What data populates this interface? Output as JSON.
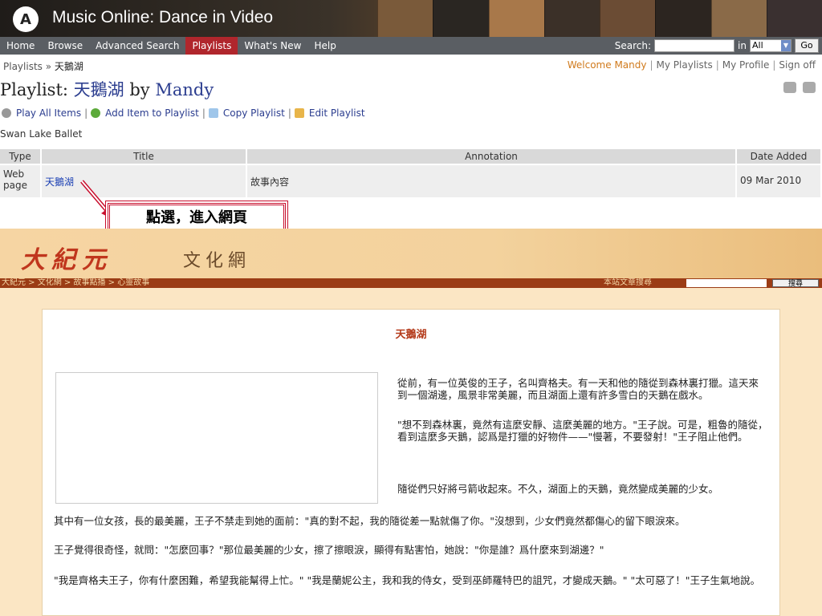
{
  "header": {
    "logo_letter": "A",
    "site_title": "Music Online: Dance in Video"
  },
  "nav": {
    "items": [
      "Home",
      "Browse",
      "Advanced Search",
      "Playlists",
      "What's New",
      "Help"
    ],
    "active": "Playlists",
    "search_label": "Search:",
    "in_label": "in",
    "scope_value": "All",
    "go_label": "Go"
  },
  "breadcrumb": {
    "root": "Playlists",
    "sep": "»",
    "current": "天鵝湖"
  },
  "userbar": {
    "welcome": "Welcome Mandy",
    "my_playlists": "My Playlists",
    "my_profile": "My Profile",
    "sign_off": "Sign off"
  },
  "playlist": {
    "label": "Playlist:",
    "name": "天鵝湖",
    "by": "by",
    "owner": "Mandy",
    "description": "Swan Lake Ballet"
  },
  "actions": {
    "play_all": "Play All Items",
    "add_item": "Add Item to Playlist",
    "copy": "Copy Playlist",
    "edit": "Edit Playlist"
  },
  "table": {
    "headers": [
      "Type",
      "Title",
      "Annotation",
      "Date Added"
    ],
    "rows": [
      {
        "type": "Web page",
        "title": "天鵝湖",
        "annotation": "故事內容",
        "date": "09 Mar 2010"
      }
    ]
  },
  "callout": {
    "text": "點選，進入網頁"
  },
  "web": {
    "brand": "大紀元",
    "brand2": "文化網",
    "breadcrumb": "大紀元 > 文化網 > 故事點播 > 心靈故事",
    "search_label": "本站文章搜尋",
    "search_button": "搜尋",
    "article_title": "天鵝湖",
    "paragraphs": [
      "從前，有一位英俊的王子，名叫齊格夫。有一天和他的隨從到森林裏打獵。這天來到一個湖邊，風景非常美麗，而且湖面上還有許多雪白的天鵝在戲水。",
      "\"想不到森林裏，竟然有這麼安靜、這麼美麗的地方。\"王子說。可是，粗魯的隨從，看到這麼多天鵝，認爲是打獵的好物件——\"慢著，不要發射！\"王子阻止他們。",
      "隨從們只好將弓箭收起來。不久，湖面上的天鵝，竟然變成美麗的少女。",
      "其中有一位女孩，長的最美麗，王子不禁走到她的面前：\"真的對不起，我的隨從差一點就傷了你。\"沒想到，少女們竟然都傷心的留下眼淚來。",
      "王子覺得很奇怪，就問：\"怎麼回事？\"那位最美麗的少女，擦了擦眼淚，顯得有點害怕，她說：\"你是誰？爲什麼來到湖邊？\"",
      "\"我是齊格夫王子，你有什麼困難，希望我能幫得上忙。\" \"我是蘭妮公主，我和我的侍女，受到巫師羅特巴的詛咒，才變成天鵝。\" \"太可惡了！\"王子生氣地說。"
    ]
  }
}
